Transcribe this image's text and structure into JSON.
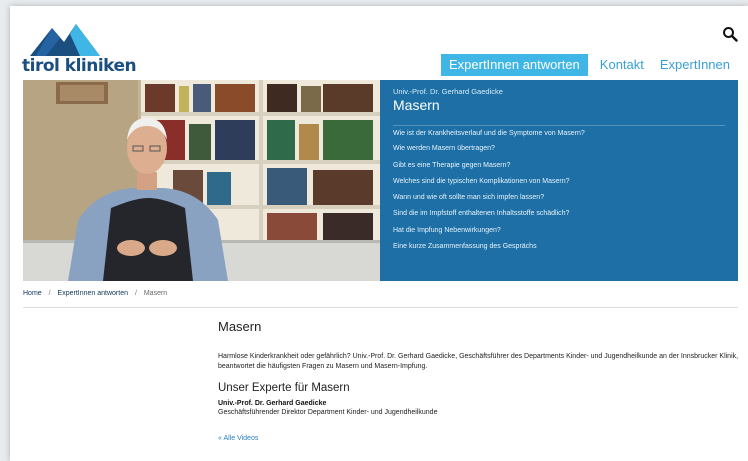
{
  "header": {
    "logo_text": "tirol kliniken",
    "nav": [
      {
        "label": "ExpertInnen antworten",
        "active": true
      },
      {
        "label": "Kontakt",
        "active": false
      },
      {
        "label": "ExpertInnen",
        "active": false
      }
    ]
  },
  "hero": {
    "expert": "Univ.-Prof. Dr. Gerhard Gaedicke",
    "title": "Masern",
    "questions": [
      "Wie ist der Krankheitsverlauf und die Symptome von Masern?",
      "Wie werden Masern übertragen?",
      "Gibt es eine Therapie gegen Masern?",
      "Welches sind die typischen Komplikationen von Masern?",
      "Wann und wie oft sollte man sich impfen lassen?",
      "Sind die im Impfstoff enthaltenen Inhaltsstoffe schädlich?",
      "Hat die Impfung Nebenwirkungen?",
      "Eine kurze Zusammenfassung des Gesprächs"
    ]
  },
  "breadcrumb": {
    "home": "Home",
    "sep": "/",
    "section": "ExpertInnen antworten",
    "current": "Masern"
  },
  "content": {
    "title": "Masern",
    "intro": "Harmlose Kinderkrankheit oder gefährlich? Univ.-Prof. Dr. Gerhard Gaedicke, Geschäftsführer des Departments Kinder- und Jugendheilkunde an der Innsbrucker Klinik, beantwortet die häufigsten Fragen zu Masern und Masern-Impfung.",
    "expert_heading": "Unser Experte für Masern",
    "expert_name": "Univ.-Prof. Dr. Gerhard Gaedicke",
    "expert_role": "Geschäftsführender Direktor Department Kinder- und Jugendheilkunde",
    "all_videos": "« Alle Videos"
  },
  "colors": {
    "brand_dark": "#1b4f80",
    "accent": "#3fb6e6",
    "panel": "#1d6fa5",
    "link": "#2a7fc0"
  }
}
